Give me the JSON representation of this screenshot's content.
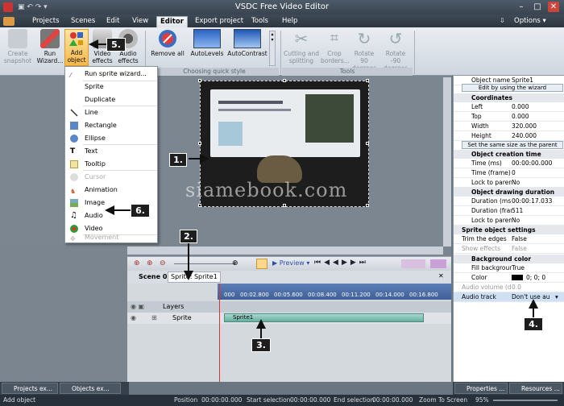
{
  "window": {
    "title": "VSDC Free Video Editor"
  },
  "menu": {
    "items": [
      "Projects",
      "Scenes",
      "Edit",
      "View",
      "Editor",
      "Export project",
      "Tools",
      "Help"
    ],
    "active": "Editor",
    "options": "Options"
  },
  "ribbon": {
    "buttons": [
      {
        "label": "Create snapshot"
      },
      {
        "label": "Run Wizard..."
      },
      {
        "label": "Add object"
      },
      {
        "label": "Video effects"
      },
      {
        "label": "Audio effects"
      },
      {
        "label": "Remove all"
      },
      {
        "label": "AutoLevels"
      },
      {
        "label": "AutoContrast"
      },
      {
        "label": "Cutting and splitting"
      },
      {
        "label": "Crop borders..."
      },
      {
        "label": "Rotate 90 degrees"
      },
      {
        "label": "Rotate -90 degrees"
      }
    ],
    "groups": {
      "quick_style": "Choosing quick style",
      "tools": "Tools"
    }
  },
  "dropdown": {
    "items": [
      {
        "label": "Run sprite wizard...",
        "icon": "wizard-icon",
        "disabled": false
      },
      {
        "label": "Sprite",
        "icon": "sprite-icon",
        "disabled": false
      },
      {
        "label": "Duplicate",
        "icon": "duplicate-icon",
        "disabled": false
      },
      {
        "label": "Line",
        "icon": "line-icon",
        "disabled": false
      },
      {
        "label": "Rectangle",
        "icon": "rectangle-icon",
        "disabled": false
      },
      {
        "label": "Ellipse",
        "icon": "ellipse-icon",
        "disabled": false
      },
      {
        "label": "Text",
        "icon": "text-icon",
        "disabled": false
      },
      {
        "label": "Tooltip",
        "icon": "tooltip-icon",
        "disabled": false
      },
      {
        "label": "Cursor",
        "icon": "cursor-icon",
        "disabled": true
      },
      {
        "label": "Animation",
        "icon": "animation-icon",
        "disabled": false
      },
      {
        "label": "Image",
        "icon": "image-icon",
        "disabled": false
      },
      {
        "label": "Audio",
        "icon": "audio-icon",
        "disabled": false
      },
      {
        "label": "Video",
        "icon": "video-icon",
        "disabled": false
      },
      {
        "label": "Movement",
        "icon": "movement-icon",
        "disabled": true
      }
    ]
  },
  "callouts": [
    "1.",
    "2.",
    "3.",
    "4.",
    "5.",
    "6."
  ],
  "watermark": "siamebook.com",
  "timeline": {
    "preview": "Preview",
    "tabs": [
      "Scene 0",
      "Sprite: Sprite1"
    ],
    "layers": "Layers",
    "track": "Sprite",
    "clip": "Sprite1",
    "ticks": [
      "000",
      "00:02.800",
      "00:05.600",
      "00:08.400",
      "00:11.200",
      "00:14.000",
      "00:16.800"
    ]
  },
  "properties": {
    "object_name_label": "Object name",
    "object_name_value": "Sprite1",
    "wizard_btn": "Edit by using the wizard",
    "coordinates": "Coordinates",
    "left": {
      "k": "Left",
      "v": "0.000"
    },
    "top": {
      "k": "Top",
      "v": "0.000"
    },
    "width": {
      "k": "Width",
      "v": "320.000"
    },
    "height": {
      "k": "Height",
      "v": "240.000"
    },
    "same_size_btn": "Set the same size as the parent",
    "creation_time": "Object creation time",
    "time_ms": {
      "k": "Time (ms)",
      "v": "00:00:00.000"
    },
    "time_frame": {
      "k": "Time (frame)",
      "v": "0"
    },
    "lock_parent": {
      "k": "Lock to parent",
      "v": "No"
    },
    "drawing_duration": "Object drawing duration",
    "duration_ms": {
      "k": "Duration (ms)",
      "v": "00:00:17.033"
    },
    "duration_frame": {
      "k": "Duration (fran",
      "v": "511"
    },
    "lock_parent2": {
      "k": "Lock to parent",
      "v": "No"
    },
    "sprite_settings": "Sprite object settings",
    "trim_edges": {
      "k": "Trim the edges",
      "v": "False"
    },
    "show_effects": {
      "k": "Show effects",
      "v": "False"
    },
    "bg_color": "Background color",
    "fill_bg": {
      "k": "Fill background",
      "v": "True"
    },
    "color": {
      "k": "Color",
      "v": "0; 0; 0"
    },
    "audio_volume": {
      "k": "Audio volume (dB",
      "v": "0.0"
    },
    "audio_track": {
      "k": "Audio track",
      "v": "Don't use au"
    }
  },
  "bottom_tabs": {
    "left": [
      "Projects ex...",
      "Objects ex..."
    ],
    "right": [
      "Properties ...",
      "Resources ..."
    ]
  },
  "status": {
    "left": "Add object",
    "position_label": "Position",
    "position": "00:00:00.000",
    "start_label": "Start selection",
    "start": "00:00:00.000",
    "end_label": "End selection",
    "end": "00:00:00.000",
    "zoom": "Zoom To Screen",
    "percent": "95%"
  },
  "colors": {
    "accent": "#f5b94a",
    "dark": "#2c3640",
    "clip": "#7fc0b3"
  }
}
